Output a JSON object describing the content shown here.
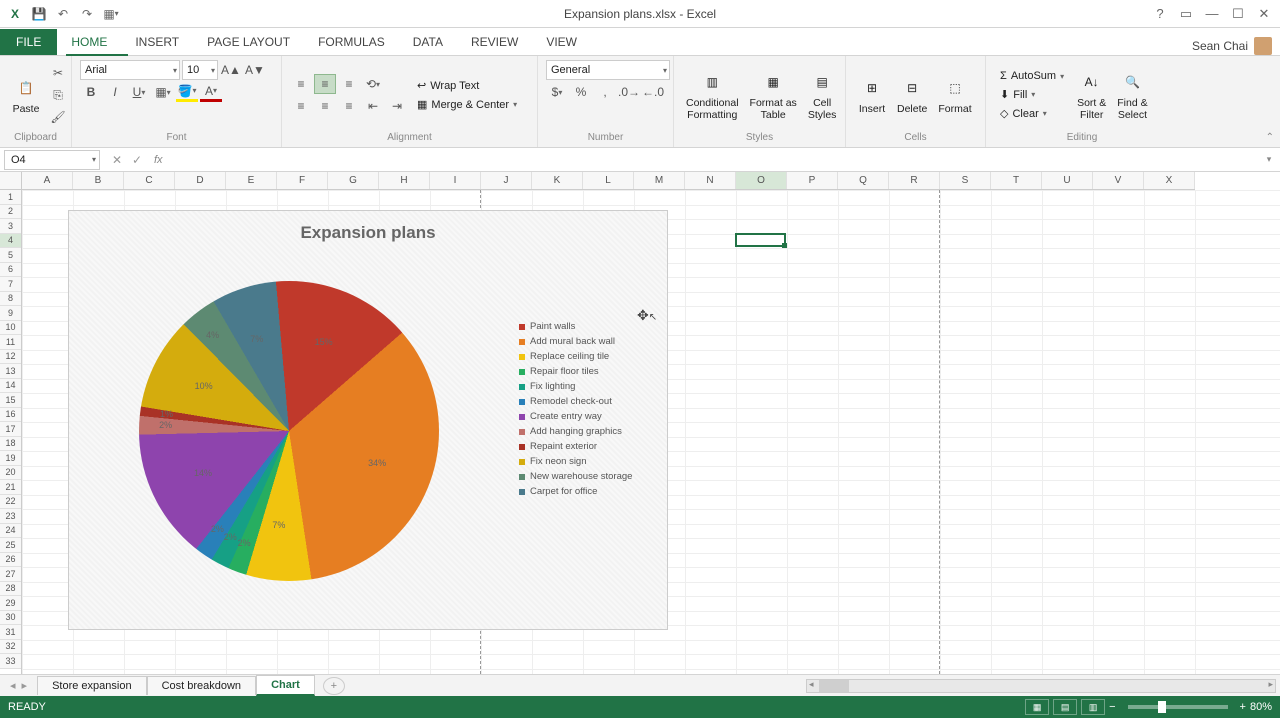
{
  "title": "Expansion plans.xlsx - Excel",
  "user_name": "Sean Chai",
  "tabs": {
    "file": "FILE",
    "home": "HOME",
    "insert": "INSERT",
    "page_layout": "PAGE LAYOUT",
    "formulas": "FORMULAS",
    "data": "DATA",
    "review": "REVIEW",
    "view": "VIEW"
  },
  "ribbon": {
    "clipboard": {
      "label": "Clipboard",
      "paste": "Paste"
    },
    "font": {
      "label": "Font",
      "name": "Arial",
      "size": "10"
    },
    "alignment": {
      "label": "Alignment",
      "wrap": "Wrap Text",
      "merge": "Merge & Center"
    },
    "number": {
      "label": "Number",
      "format": "General"
    },
    "styles": {
      "label": "Styles",
      "cond": "Conditional\nFormatting",
      "table": "Format as\nTable",
      "cell": "Cell\nStyles"
    },
    "cells": {
      "label": "Cells",
      "insert": "Insert",
      "delete": "Delete",
      "format": "Format"
    },
    "editing": {
      "label": "Editing",
      "autosum": "AutoSum",
      "fill": "Fill",
      "clear": "Clear",
      "sort": "Sort &\nFilter",
      "find": "Find &\nSelect"
    }
  },
  "namebox": "O4",
  "columns": [
    "A",
    "B",
    "C",
    "D",
    "E",
    "F",
    "G",
    "H",
    "I",
    "J",
    "K",
    "L",
    "M",
    "N",
    "O",
    "P",
    "Q",
    "R",
    "S",
    "T",
    "U",
    "V",
    "X"
  ],
  "selected_col": "O",
  "selected_row": 4,
  "sheets": {
    "s1": "Store expansion",
    "s2": "Cost breakdown",
    "s3": "Chart"
  },
  "status": {
    "ready": "READY",
    "zoom": "80%"
  },
  "chart_data": {
    "type": "pie",
    "title": "Expansion plans",
    "series": [
      {
        "name": "Paint walls",
        "value": 15,
        "color": "#c0392b"
      },
      {
        "name": "Add mural back wall",
        "value": 34,
        "color": "#e67e22"
      },
      {
        "name": "Replace ceiling tile",
        "value": 7,
        "color": "#f1c40f"
      },
      {
        "name": "Repair floor tiles",
        "value": 2,
        "color": "#27ae60"
      },
      {
        "name": "Fix lighting",
        "value": 2,
        "color": "#16a085"
      },
      {
        "name": "Remodel check-out",
        "value": 2,
        "color": "#2980b9"
      },
      {
        "name": "Create entry way",
        "value": 14,
        "color": "#8e44ad"
      },
      {
        "name": "Add hanging graphics",
        "value": 2,
        "color": "#c0706b"
      },
      {
        "name": "Repaint exterior",
        "value": 1,
        "color": "#a93226"
      },
      {
        "name": "Fix neon sign",
        "value": 10,
        "color": "#d4ac0d"
      },
      {
        "name": "New warehouse storage",
        "value": 4,
        "color": "#5d8a72"
      },
      {
        "name": "Carpet for office",
        "value": 7,
        "color": "#4a7a8c"
      }
    ]
  }
}
